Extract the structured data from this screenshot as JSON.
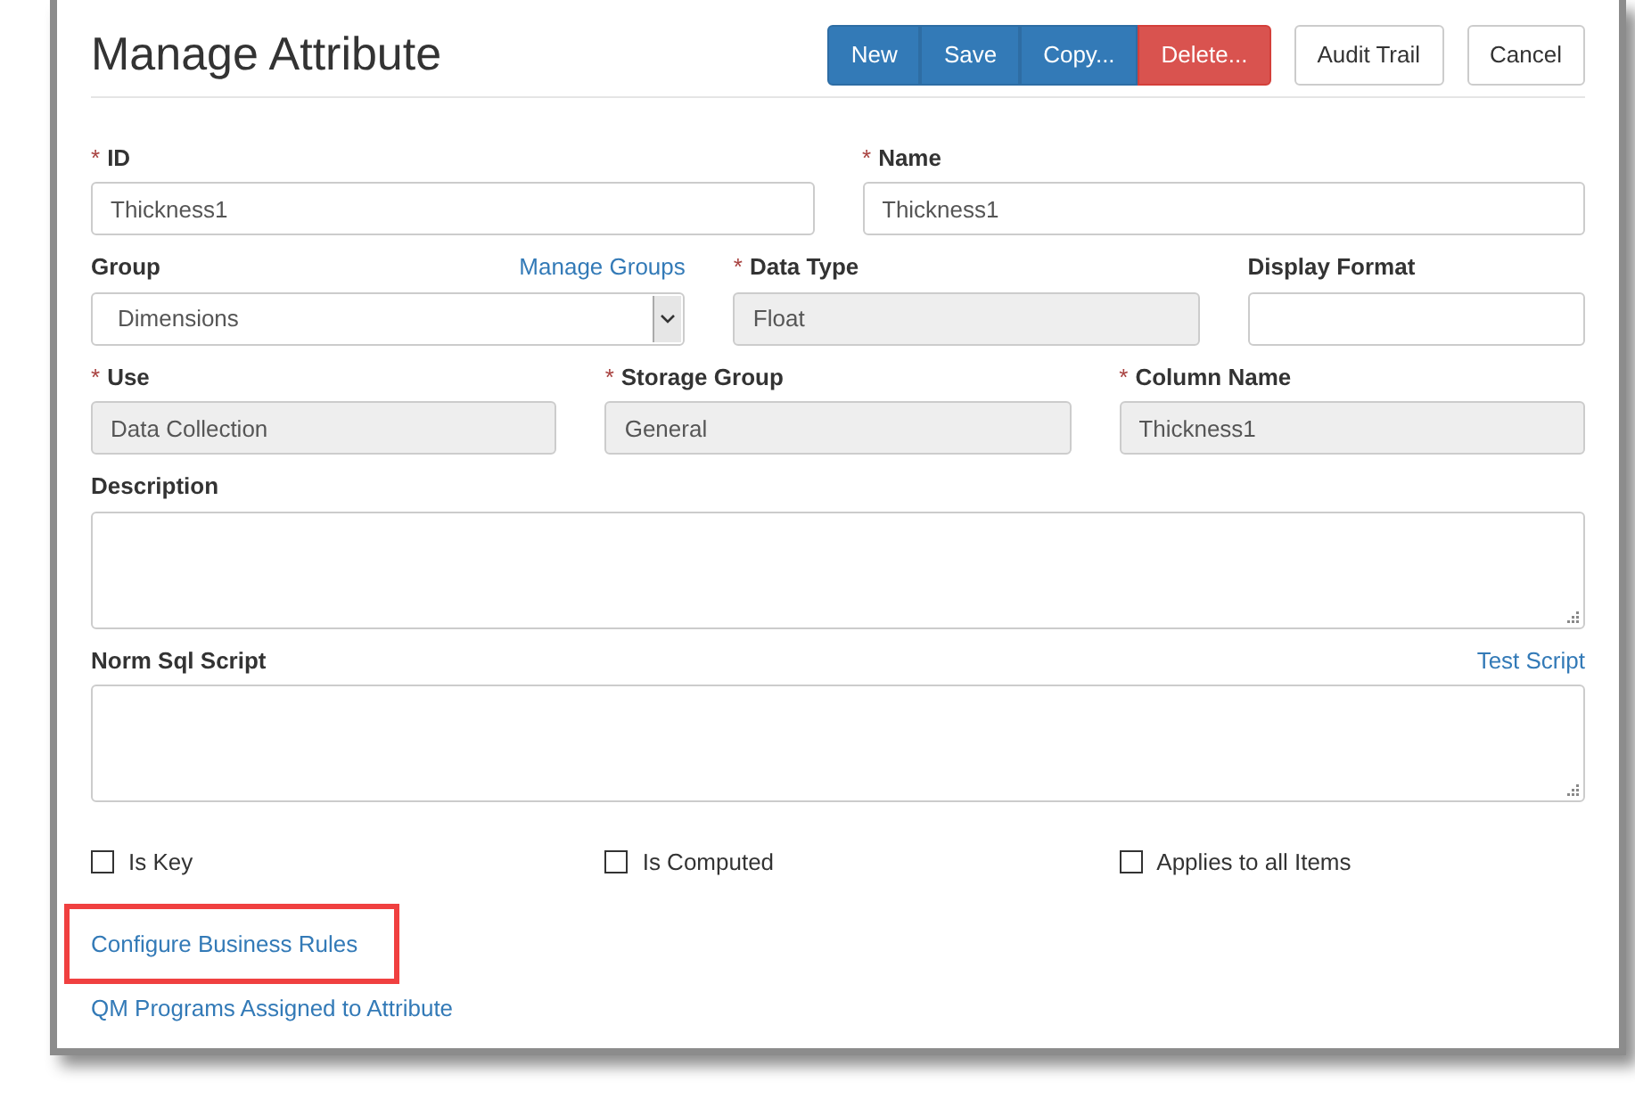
{
  "title": "Manage Attribute",
  "toolbar": [
    {
      "label": "New",
      "kind": "primary"
    },
    {
      "label": "Save",
      "kind": "primary"
    },
    {
      "label": "Copy...",
      "kind": "primary"
    },
    {
      "label": "Delete...",
      "kind": "danger"
    },
    {
      "label": "Audit Trail",
      "kind": "default"
    },
    {
      "label": "Cancel",
      "kind": "default"
    }
  ],
  "rows": [
    [
      {
        "marker": "*",
        "label": "ID",
        "kind": "text",
        "value": "Thickness1",
        "disabled": false
      },
      {
        "marker": "*",
        "label": "Name",
        "kind": "text",
        "value": "Thickness1",
        "disabled": false
      }
    ],
    [
      {
        "label": "Group",
        "kind": "select",
        "value": "Dimensions",
        "disabled": false,
        "link": "Manage Groups"
      },
      {
        "marker": "*",
        "label": "Data Type",
        "kind": "text",
        "value": "Float",
        "disabled": true
      },
      {
        "label": "Display Format",
        "kind": "text",
        "disabled": false
      }
    ],
    [
      {
        "marker": "*",
        "label": "Use",
        "kind": "text",
        "value": "Data Collection",
        "disabled": true
      },
      {
        "marker": "*",
        "label": "Storage Group",
        "kind": "text",
        "value": "General",
        "disabled": true
      },
      {
        "marker": "*",
        "label": "Column Name",
        "kind": "text",
        "value": "Thickness1",
        "disabled": true
      }
    ],
    [
      {
        "label": "Description",
        "kind": "textarea",
        "disabled": false
      }
    ],
    [
      {
        "label": "Norm Sql Script",
        "kind": "textarea",
        "disabled": false,
        "link": "Test Script"
      }
    ]
  ],
  "checkboxes": [
    {
      "label": "Is Key",
      "checked": false
    },
    {
      "label": "Is Computed",
      "checked": false
    },
    {
      "label": "Applies to all Items",
      "checked": false
    }
  ],
  "links": [
    {
      "label": "Configure Business Rules",
      "highlighted": true
    },
    {
      "label": "QM Programs Assigned to Attribute",
      "highlighted": false
    }
  ]
}
